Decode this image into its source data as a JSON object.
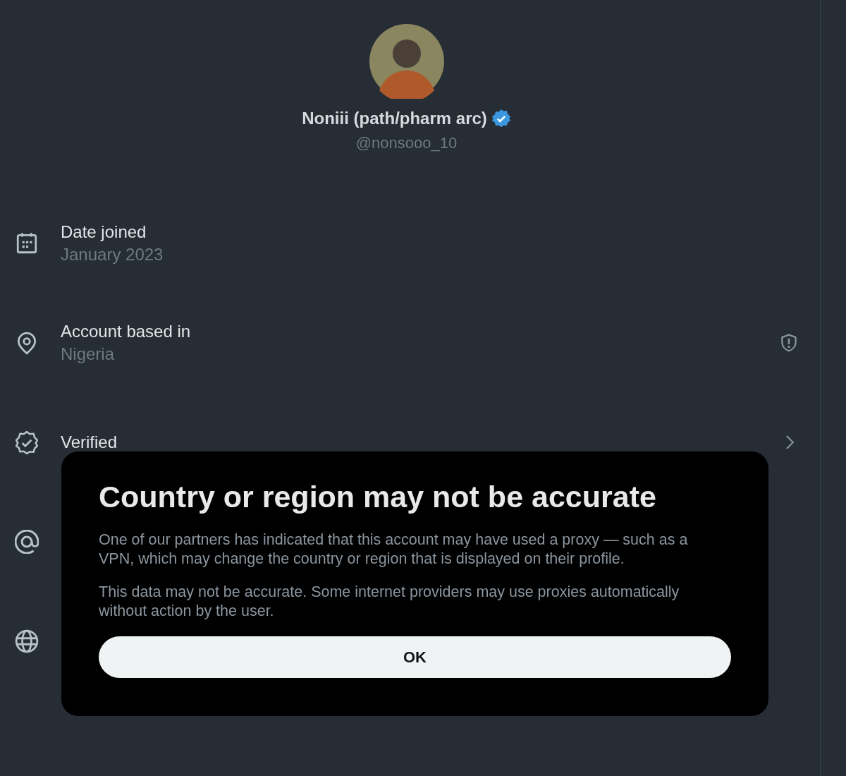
{
  "profile": {
    "display_name": "Noniii (path/pharm arc)",
    "verified": true,
    "handle": "@nonsooo_10"
  },
  "rows": [
    {
      "kind": "calendar",
      "label": "Date joined",
      "value": "January 2023"
    },
    {
      "kind": "location",
      "label": "Account based in",
      "value": "Nigeria",
      "warning": true
    },
    {
      "kind": "verified",
      "label": "Verified",
      "expandable": true
    },
    {
      "kind": "at"
    },
    {
      "kind": "globe"
    }
  ],
  "dialog": {
    "title": "Country or region may not be accurate",
    "paragraphs": [
      "One of our partners has indicated that this account may have used a proxy — such as a VPN, which may change the country or region that is displayed on their profile.",
      "This data may not be accurate. Some internet providers may use proxies automatically without action by the user."
    ],
    "button": "OK"
  }
}
